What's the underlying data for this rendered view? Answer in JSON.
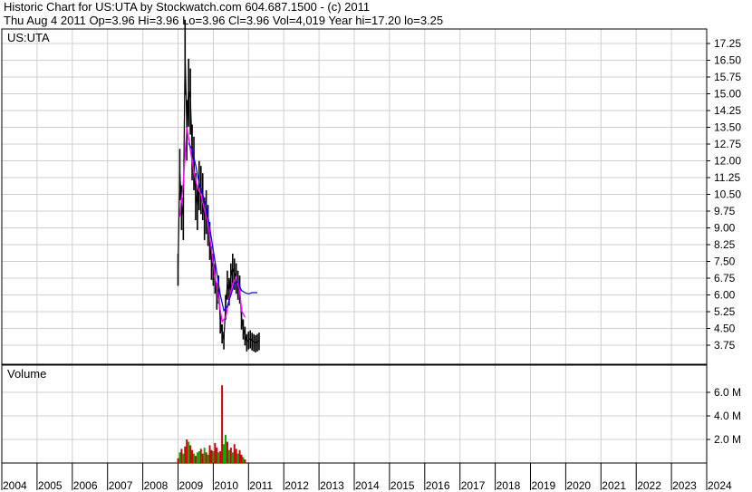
{
  "header": {
    "title": "Historic Chart for US:UTA by Stockwatch.com 604.687.1500 - (c) 2011",
    "quote": "Thu Aug  4 2011   Op=3.96  Hi=3.96  Lo=3.96  Cl=3.96  Vol=4,019  Year hi=17.20  lo=3.25"
  },
  "chart_data": [
    {
      "type": "line",
      "panel": "price",
      "symbol_label": "US:UTA",
      "ylim": [
        3.25,
        17.6
      ],
      "yticks": [
        "17.25",
        "16.50",
        "15.75",
        "15.00",
        "14.25",
        "13.50",
        "12.75",
        "12.00",
        "11.25",
        "10.50",
        "9.75",
        "9.00",
        "8.25",
        "7.50",
        "6.75",
        "6.00",
        "5.25",
        "4.50",
        "3.75"
      ],
      "grid": true,
      "series": [
        {
          "style": "daily high-low bars",
          "x": [
            2009.0,
            2009.05,
            2009.1,
            2009.15,
            2009.2,
            2009.25,
            2009.3,
            2009.35,
            2009.4,
            2009.45,
            2009.5,
            2009.55,
            2009.6,
            2009.65,
            2009.7,
            2009.75,
            2009.8,
            2009.85,
            2009.9,
            2009.95,
            2010.0,
            2010.05,
            2010.1,
            2010.15,
            2010.2,
            2010.25,
            2010.3,
            2010.35,
            2010.4,
            2010.45,
            2010.5,
            2010.55,
            2010.6,
            2010.65,
            2010.7,
            2010.75,
            2010.8,
            2010.85,
            2010.9,
            2010.95,
            2011.0,
            2011.05,
            2011.1,
            2011.15,
            2011.2,
            2011.25,
            2011.3
          ],
          "values": [
            7.2,
            11.5,
            10.0,
            9.5,
            16.8,
            13.5,
            15.2,
            14.8,
            12.5,
            12.0,
            10.5,
            10.0,
            11.0,
            10.8,
            10.5,
            9.5,
            9.8,
            9.2,
            8.5,
            7.5,
            7.2,
            6.8,
            6.0,
            6.3,
            4.8,
            4.3,
            4.0,
            5.5,
            6.5,
            6.2,
            6.8,
            7.2,
            7.0,
            6.8,
            6.5,
            6.3,
            5.0,
            4.5,
            4.2,
            3.9,
            4.0,
            4.05,
            3.95,
            3.9,
            3.85,
            3.9,
            3.96
          ]
        },
        {
          "style": "daily closes",
          "x": [
            2009.0,
            2009.05,
            2009.1,
            2009.15,
            2009.2,
            2009.25,
            2009.3,
            2009.35,
            2009.4,
            2009.45,
            2009.5,
            2009.55,
            2009.6,
            2009.65,
            2009.7,
            2009.75,
            2009.8,
            2009.85,
            2009.9,
            2009.95,
            2010.0,
            2010.05,
            2010.1,
            2010.15,
            2010.2,
            2010.25,
            2010.3,
            2010.35,
            2010.4,
            2010.45,
            2010.5,
            2010.55,
            2010.6,
            2010.65,
            2010.7,
            2010.75,
            2010.8,
            2010.85,
            2010.9,
            2010.95,
            2011.0,
            2011.05,
            2011.1,
            2011.15,
            2011.2,
            2011.25,
            2011.3
          ],
          "values": [
            7.2,
            11.5,
            10.0,
            9.5,
            16.8,
            13.5,
            15.2,
            14.8,
            12.5,
            12.0,
            10.5,
            10.0,
            11.0,
            10.8,
            10.5,
            9.5,
            9.8,
            9.2,
            8.5,
            7.5,
            7.2,
            6.8,
            6.0,
            6.3,
            4.8,
            4.3,
            4.0,
            5.5,
            6.5,
            6.2,
            6.8,
            7.2,
            7.0,
            6.8,
            6.5,
            6.3,
            5.0,
            4.5,
            4.2,
            3.9,
            4.0,
            4.05,
            3.95,
            3.9,
            3.85,
            3.9,
            3.96
          ],
          "color": "#000000"
        },
        {
          "style": "short moving average",
          "x": [
            2009.05,
            2009.15,
            2009.25,
            2009.35,
            2009.45,
            2009.55,
            2009.65,
            2009.75,
            2009.85,
            2009.95,
            2010.05,
            2010.15,
            2010.25,
            2010.35,
            2010.45,
            2010.55,
            2010.65,
            2010.75,
            2010.8,
            2010.9
          ],
          "values": [
            9.5,
            11.0,
            13.5,
            12.5,
            11.5,
            10.8,
            10.5,
            9.8,
            9.2,
            8.0,
            6.8,
            5.8,
            4.8,
            5.0,
            5.8,
            6.5,
            6.8,
            6.2,
            5.3,
            5.0
          ],
          "color": "#ff00ff"
        },
        {
          "style": "long moving average",
          "x": [
            2009.3,
            2009.4,
            2009.5,
            2009.6,
            2009.7,
            2009.8,
            2009.9,
            2010.0,
            2010.1,
            2010.2,
            2010.3,
            2010.4,
            2010.5,
            2010.6,
            2010.7,
            2010.8,
            2010.9,
            2011.0,
            2011.1,
            2011.25
          ],
          "values": [
            12.8,
            12.5,
            11.8,
            11.0,
            10.5,
            10.0,
            9.0,
            8.0,
            7.0,
            6.0,
            5.3,
            5.5,
            6.0,
            6.5,
            6.6,
            6.2,
            6.1,
            6.05,
            6.1,
            6.1
          ],
          "color": "#0000ff"
        }
      ]
    },
    {
      "type": "bar",
      "panel": "volume",
      "label": "Volume",
      "ylim": [
        0,
        8.0
      ],
      "yticks": [
        "6.0 M",
        "4.0 M",
        "2.0 M"
      ],
      "series": [
        {
          "style": "volume bars, red = down day, green = up day",
          "x": [
            2009.0,
            2009.05,
            2009.1,
            2009.15,
            2009.2,
            2009.25,
            2009.3,
            2009.35,
            2009.4,
            2009.45,
            2009.5,
            2009.55,
            2009.6,
            2009.65,
            2009.7,
            2009.75,
            2009.8,
            2009.85,
            2009.9,
            2009.95,
            2010.0,
            2010.05,
            2010.1,
            2010.15,
            2010.2,
            2010.25,
            2010.3,
            2010.35,
            2010.4,
            2010.45,
            2010.5,
            2010.55,
            2010.6,
            2010.65,
            2010.7,
            2010.75,
            2010.8,
            2010.85,
            2010.9
          ],
          "values": [
            0.4,
            0.9,
            1.2,
            0.8,
            1.4,
            2.0,
            1.8,
            1.5,
            1.1,
            0.8,
            0.6,
            0.9,
            1.0,
            1.2,
            0.8,
            1.3,
            0.9,
            0.7,
            1.5,
            1.1,
            1.0,
            1.7,
            1.3,
            0.9,
            1.0,
            6.6,
            1.6,
            2.4,
            1.8,
            1.1,
            1.3,
            0.9,
            1.6,
            1.2,
            0.8,
            1.1,
            0.7,
            0.5,
            0.3
          ],
          "colors": [
            "#cc0000",
            "#00aa00",
            "#cc0000",
            "#00aa00",
            "#cc0000",
            "#cc0000",
            "#00aa00",
            "#cc0000",
            "#cc0000",
            "#00aa00",
            "#cc0000",
            "#00aa00",
            "#00aa00",
            "#cc0000",
            "#cc0000",
            "#00aa00",
            "#cc0000",
            "#00aa00",
            "#cc0000",
            "#cc0000",
            "#00aa00",
            "#cc0000",
            "#cc0000",
            "#00aa00",
            "#cc0000",
            "#cc0000",
            "#00aa00",
            "#00aa00",
            "#cc0000",
            "#00aa00",
            "#cc0000",
            "#00aa00",
            "#cc0000",
            "#cc0000",
            "#00aa00",
            "#cc0000",
            "#cc0000",
            "#00aa00",
            "#cc0000"
          ]
        }
      ]
    },
    {
      "type": "axis",
      "panel": "time axis",
      "xlim": [
        2004,
        2024
      ],
      "categories": [
        "2004",
        "2005",
        "2006",
        "2007",
        "2008",
        "2009",
        "2010",
        "2011",
        "2012",
        "2013",
        "2014",
        "2015",
        "2016",
        "2017",
        "2018",
        "2019",
        "2020",
        "2021",
        "2022",
        "2023",
        "2024"
      ]
    }
  ]
}
